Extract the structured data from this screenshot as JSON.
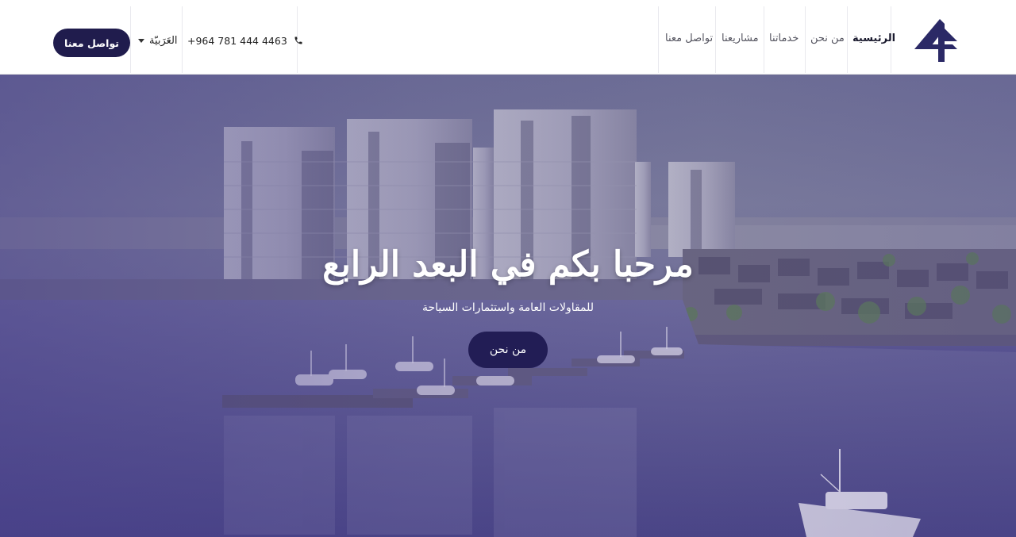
{
  "brand": {
    "logo_icon": "brand-4-logo-icon",
    "brand_color": "#2b2966"
  },
  "nav": {
    "items": [
      {
        "label": "الرئيسية",
        "active": true
      },
      {
        "label": "من نحن",
        "active": false
      },
      {
        "label": "خدماتنا",
        "active": false
      },
      {
        "label": "مشاريعنا",
        "active": false
      },
      {
        "label": "تواصل معنا",
        "active": false
      }
    ]
  },
  "header": {
    "phone": "+964 781 444 4463",
    "phone_icon": "phone-icon",
    "language": "العَرَبيّة",
    "language_icon": "caret-down-icon",
    "cta_label": "تواصل معنا",
    "cta_color": "#201c4d"
  },
  "hero": {
    "title": "مرحبا بكم في البعد الرابع",
    "subtitle": "للمقاولات العامة واستثمارات السياحة",
    "button_label": "من نحن",
    "button_color": "#221d55",
    "overlay_color": "#4c4788"
  }
}
